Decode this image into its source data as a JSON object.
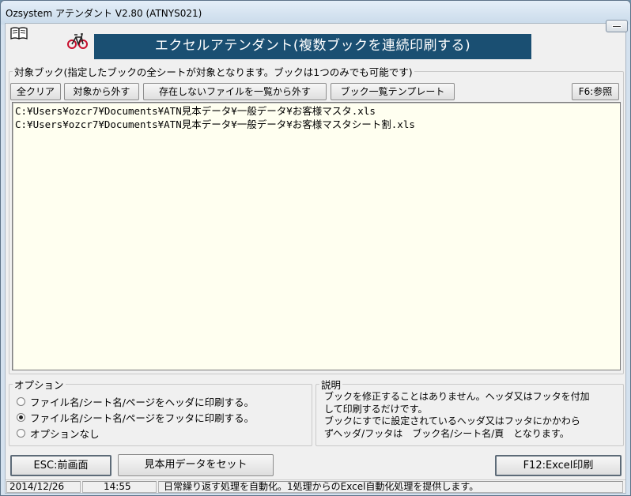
{
  "window": {
    "title": "Ozsystem アテンダント V2.80 (ATNYS021)"
  },
  "header": {
    "banner": "エクセルアテンダント(複数ブックを連続印刷する)",
    "icons": [
      "book-icon",
      "bicycle-icon",
      "close-icon"
    ]
  },
  "books": {
    "group_label": "対象ブック(指定したブックの全シートが対象となります。ブックは1つのみでも可能です)",
    "buttons": {
      "clear_all": "全クリア",
      "remove": "対象から外す",
      "remove_missing": "存在しないファイルを一覧から外す",
      "template": "ブック一覧テンプレート",
      "browse": "F6:参照"
    },
    "files": [
      "C:¥Users¥ozcr7¥Documents¥ATN見本データ¥一般データ¥お客様マスタ.xls",
      "C:¥Users¥ozcr7¥Documents¥ATN見本データ¥一般データ¥お客様マスタシート割.xls"
    ]
  },
  "options": {
    "group_label": "オプション",
    "items": [
      "ファイル名/シート名/ページをヘッダに印刷する。",
      "ファイル名/シート名/ページをフッタに印刷する。",
      "オプションなし"
    ],
    "selected_index": 1
  },
  "description": {
    "group_label": "説明",
    "lines": [
      "ブックを修正することはありません。ヘッダ又はフッタを付加",
      "して印刷するだけです。",
      "ブックにすでに設定されているヘッダ又はフッタにかかわら",
      "ずヘッダ/フッタは　ブック名/シート名/頁　となります。"
    ]
  },
  "footer_buttons": {
    "esc": "ESC:前画面",
    "sample": "見本用データをセット",
    "print": "F12:Excel印刷"
  },
  "statusbar": {
    "date": "2014/12/26",
    "time": "14:55",
    "message": "日常繰り返す処理を自動化。1処理からのExcel自動化処理を提供します。"
  },
  "colors": {
    "banner_bg": "#1a4f72",
    "list_bg": "#fffff0",
    "bike_red": "#c8102e"
  }
}
